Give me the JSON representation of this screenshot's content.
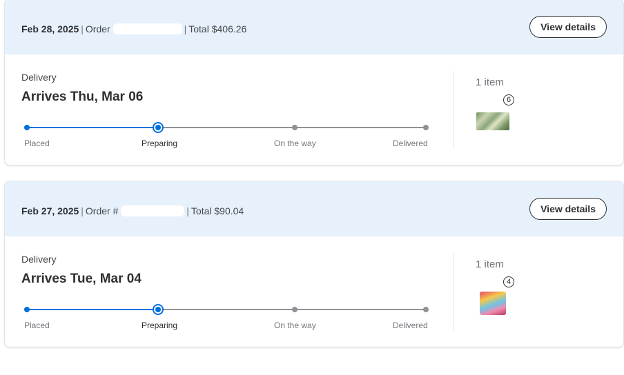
{
  "orders": [
    {
      "date": "Feb 28, 2025",
      "order_label": "Order",
      "total": "Total $406.26",
      "view_details": "View details",
      "delivery_type": "Delivery",
      "arrival": "Arrives Thu, Mar 06",
      "steps": [
        "Placed",
        "Preparing",
        "On the way",
        "Delivered"
      ],
      "current_step": "Preparing",
      "item_count": "1 item",
      "quantity": "6"
    },
    {
      "date": "Feb 27, 2025",
      "order_label": "Order #",
      "total": "Total $90.04",
      "view_details": "View details",
      "delivery_type": "Delivery",
      "arrival": "Arrives Tue, Mar 04",
      "steps": [
        "Placed",
        "Preparing",
        "On the way",
        "Delivered"
      ],
      "current_step": "Preparing",
      "item_count": "1 item",
      "quantity": "4"
    }
  ],
  "colors": {
    "header_bg": "#e6f1fc",
    "progress_active": "#0071dc",
    "progress_inactive": "#909196"
  }
}
